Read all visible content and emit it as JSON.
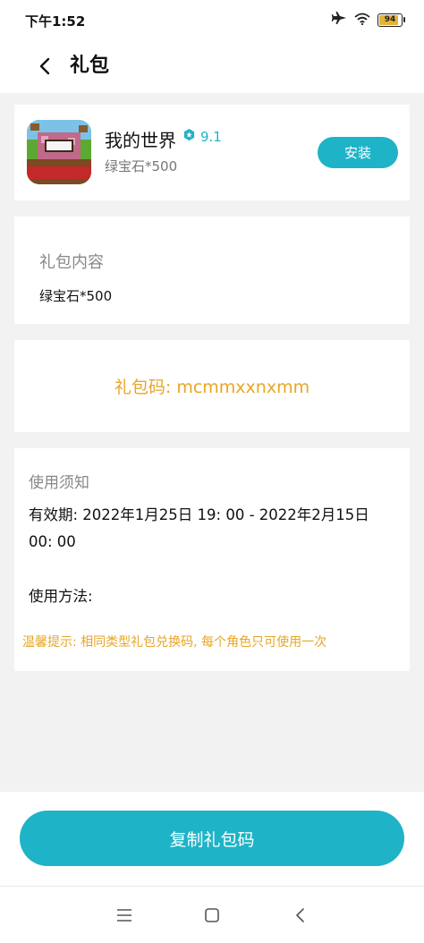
{
  "status_bar": {
    "time": "下午1:52",
    "battery": "94",
    "battery_level": 0.94,
    "icons": [
      "airplane-icon",
      "wifi-icon",
      "battery-icon"
    ]
  },
  "header": {
    "title": "礼包",
    "back_icon": "back-chevron-icon"
  },
  "app": {
    "name": "我的世界",
    "rating": "9.1",
    "rating_icon": "badge-icon",
    "subtitle": "绿宝石*500",
    "install_label": "安装",
    "accent_color": "#1fb3c7"
  },
  "gift_content": {
    "title": "礼包内容",
    "value": "绿宝石*500"
  },
  "gift_code": {
    "text": "礼包码: mcmmxxnxmm",
    "color": "#e7a626"
  },
  "notice": {
    "title": "使用须知",
    "validity": "有效期: 2022年1月25日 19: 00 - 2022年2月15日 00: 00",
    "usage": "使用方法:",
    "tip": "温馨提示: 相同类型礼包兑换码, 每个角色只可使用一次"
  },
  "footer": {
    "copy_label": "复制礼包码"
  },
  "system_nav": {
    "icons": [
      "menu-icon",
      "home-icon",
      "back-icon"
    ]
  }
}
